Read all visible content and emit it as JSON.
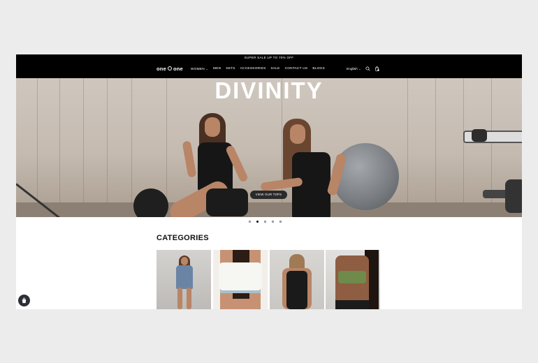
{
  "announcement": "SUPER SALE UP TO 70% OFF",
  "logo": {
    "left": "one",
    "right": "one"
  },
  "nav": [
    "WOMEN",
    "MEN",
    "SETS",
    "ACCESSORIES",
    "SALE",
    "CONTACT US",
    "BLOGS"
  ],
  "language": "English",
  "hero": {
    "title": "DIVINITY",
    "cta": "VIEW OUR TOPS",
    "slide_count": 5,
    "active_slide": 1
  },
  "categories_title": "CATEGORIES",
  "icons": {
    "search": "search-icon",
    "cart": "shopping-bag-icon",
    "chat": "shopify-chat-icon",
    "chevron": "chevron-down-icon"
  },
  "colors": {
    "header": "#000000",
    "cta": "#2a2a2a",
    "chat_button": "#2b3036"
  }
}
